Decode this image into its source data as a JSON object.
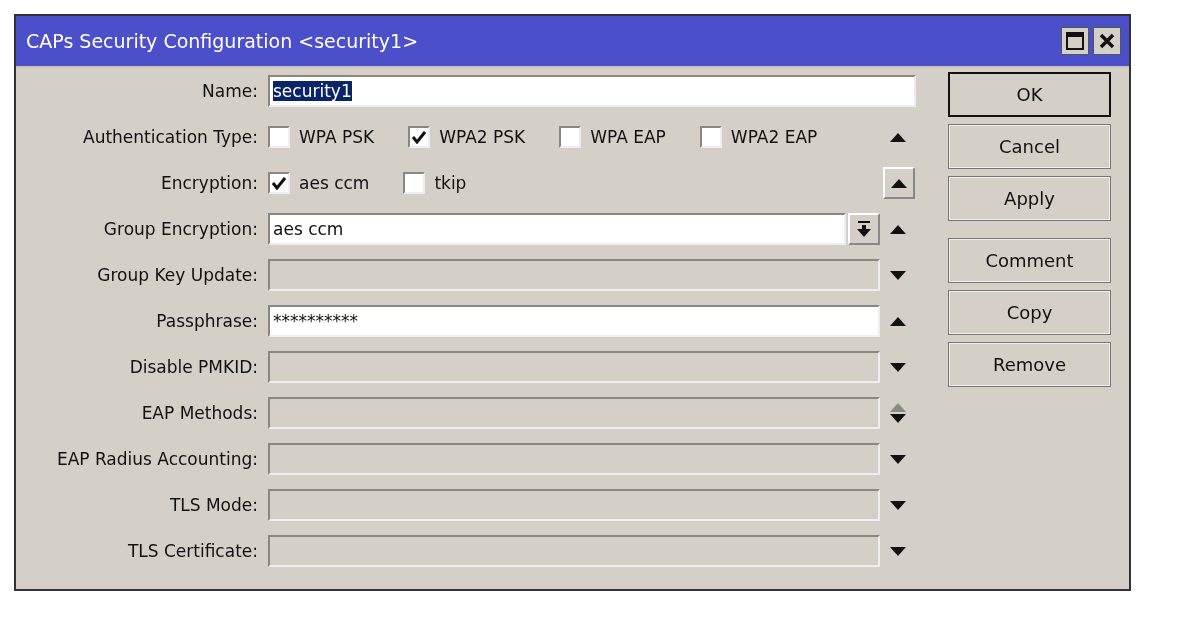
{
  "window": {
    "title": "CAPs Security Configuration <security1>"
  },
  "fields": [
    {
      "label": "Name:",
      "kind": "text",
      "value": "security1",
      "text_selected": true,
      "enabled": true
    },
    {
      "label": "Authentication Type:",
      "kind": "checks",
      "side": {
        "kind": "up"
      },
      "options": [
        {
          "label": "WPA PSK",
          "checked": false
        },
        {
          "label": "WPA2 PSK",
          "checked": true
        },
        {
          "label": "WPA EAP",
          "checked": false
        },
        {
          "label": "WPA2 EAP",
          "checked": false
        }
      ]
    },
    {
      "label": "Encryption:",
      "kind": "checks",
      "side": {
        "kind": "up-button"
      },
      "options": [
        {
          "label": "aes ccm",
          "checked": true
        },
        {
          "label": "tkip",
          "checked": false
        }
      ]
    },
    {
      "label": "Group Encryption:",
      "kind": "combo",
      "value": "aes ccm",
      "enabled": true,
      "side": {
        "kind": "up"
      }
    },
    {
      "label": "Group Key Update:",
      "kind": "text",
      "enabled": false,
      "side": {
        "kind": "down"
      }
    },
    {
      "label": "Passphrase:",
      "kind": "text",
      "value": "**********",
      "enabled": true,
      "side": {
        "kind": "up"
      }
    },
    {
      "label": "Disable PMKID:",
      "kind": "text",
      "enabled": false,
      "side": {
        "kind": "down"
      }
    },
    {
      "label": "EAP Methods:",
      "kind": "text",
      "enabled": false,
      "side": {
        "kind": "updown"
      }
    },
    {
      "label": "EAP Radius Accounting:",
      "kind": "text",
      "enabled": false,
      "side": {
        "kind": "down"
      }
    },
    {
      "label": "TLS Mode:",
      "kind": "text",
      "enabled": false,
      "side": {
        "kind": "down"
      }
    },
    {
      "label": "TLS Certificate:",
      "kind": "text",
      "enabled": false,
      "side": {
        "kind": "down"
      }
    }
  ],
  "button_groups": [
    [
      {
        "label": "OK",
        "default": true
      },
      {
        "label": "Cancel",
        "default": false
      },
      {
        "label": "Apply",
        "default": false
      }
    ],
    [
      {
        "label": "Comment",
        "default": false
      },
      {
        "label": "Copy",
        "default": false
      },
      {
        "label": "Remove",
        "default": false
      }
    ]
  ]
}
